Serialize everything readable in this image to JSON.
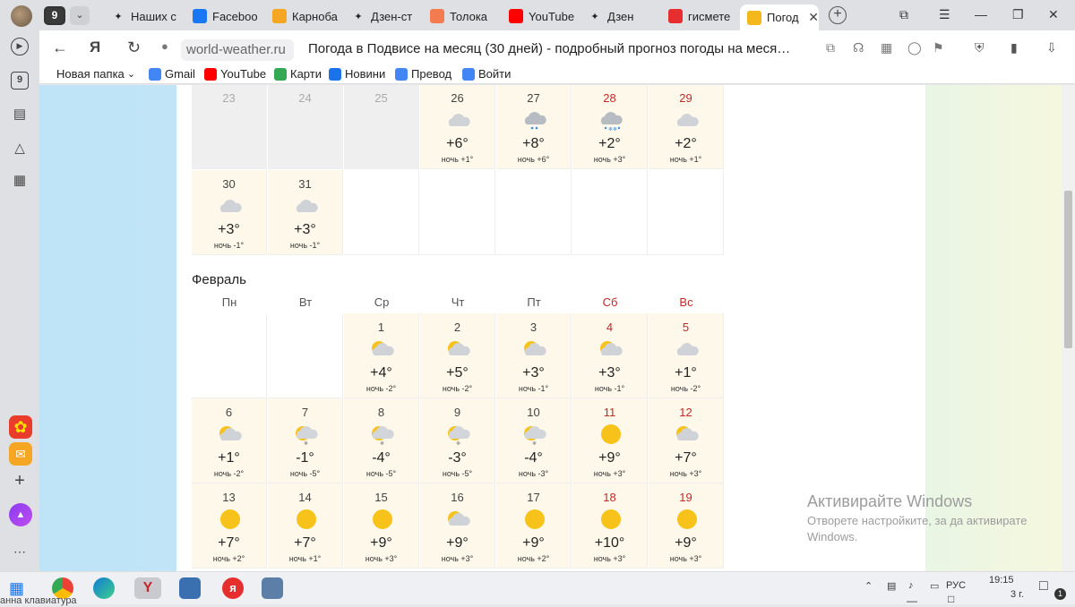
{
  "browser": {
    "tab_count": "9",
    "tabs": [
      {
        "label": "Наших с",
        "icon": "sparkle-icon",
        "color": "#222"
      },
      {
        "label": "Faceboo",
        "icon": "facebook-icon",
        "color": "#1877f2"
      },
      {
        "label": "Карноба",
        "icon": "k-logo-icon",
        "color": "#f5a623"
      },
      {
        "label": "Дзен-ст",
        "icon": "sparkle-icon",
        "color": "#222"
      },
      {
        "label": "Толока",
        "icon": "toloka-icon",
        "color": "#f47b4f"
      },
      {
        "label": "YouTube",
        "icon": "youtube-icon",
        "color": "#ff0000"
      },
      {
        "label": "Дзен",
        "icon": "sparkle-icon",
        "color": "#222"
      },
      {
        "label": "гисмете",
        "icon": "yandex-icon",
        "color": "#e62e2e"
      },
      {
        "label": "Погод",
        "icon": "weather-icon",
        "color": "#f5b81c",
        "active": true
      }
    ],
    "url": "world-weather.ru",
    "page_title": "Погода в Подвисе на месяц (30 дней) - подробный прогноз погоды на меся…",
    "bookmarks": [
      {
        "label": "Новая папка",
        "icon": "chevron-down-icon"
      },
      {
        "label": "Gmail",
        "icon": "google-icon",
        "color": "#4285f4"
      },
      {
        "label": "YouTube",
        "icon": "youtube-icon",
        "color": "#ff0000"
      },
      {
        "label": "Карти",
        "icon": "maps-icon",
        "color": "#34a853"
      },
      {
        "label": "Новини",
        "icon": "news-icon",
        "color": "#1a73e8"
      },
      {
        "label": "Превод",
        "icon": "translate-icon",
        "color": "#4285f4"
      },
      {
        "label": "Войти",
        "icon": "google-icon",
        "color": "#4285f4"
      }
    ]
  },
  "calendar": {
    "january_rows": [
      [
        {
          "day": "23",
          "state": "past"
        },
        {
          "day": "24",
          "state": "past"
        },
        {
          "day": "25",
          "state": "past"
        },
        {
          "day": "26",
          "state": "fc",
          "weather": "cloudy",
          "temp": "+6°",
          "night": "ночь +1°"
        },
        {
          "day": "27",
          "state": "fc",
          "weather": "rain",
          "temp": "+8°",
          "night": "ночь +6°"
        },
        {
          "day": "28",
          "state": "fc",
          "weather": "sleet",
          "temp": "+2°",
          "night": "ночь +3°",
          "weekend": true
        },
        {
          "day": "29",
          "state": "fc",
          "weather": "cloudy",
          "temp": "+2°",
          "night": "ночь +1°",
          "weekend": true
        }
      ],
      [
        {
          "day": "30",
          "state": "fc",
          "weather": "cloudy",
          "temp": "+3°",
          "night": "ночь -1°"
        },
        {
          "day": "31",
          "state": "fc",
          "weather": "cloudy",
          "temp": "+3°",
          "night": "ночь -1°"
        },
        {
          "day": "",
          "state": "empty"
        },
        {
          "day": "",
          "state": "empty"
        },
        {
          "day": "",
          "state": "empty"
        },
        {
          "day": "",
          "state": "empty"
        },
        {
          "day": "",
          "state": "empty"
        }
      ]
    ],
    "month_label": "Февраль",
    "weekdays": [
      "Пн",
      "Вт",
      "Ср",
      "Чт",
      "Пт",
      "Сб",
      "Вс"
    ],
    "february_rows": [
      [
        {
          "day": "",
          "state": "empty"
        },
        {
          "day": "",
          "state": "empty"
        },
        {
          "day": "1",
          "state": "fc",
          "weather": "partly",
          "temp": "+4°",
          "night": "ночь -2°"
        },
        {
          "day": "2",
          "state": "fc",
          "weather": "partly",
          "temp": "+5°",
          "night": "ночь -2°"
        },
        {
          "day": "3",
          "state": "fc",
          "weather": "partly",
          "temp": "+3°",
          "night": "ночь -1°"
        },
        {
          "day": "4",
          "state": "fc",
          "weather": "partly",
          "temp": "+3°",
          "night": "ночь -1°",
          "weekend": true
        },
        {
          "day": "5",
          "state": "fc",
          "weather": "cloudy",
          "temp": "+1°",
          "night": "ночь -2°",
          "weekend": true
        }
      ],
      [
        {
          "day": "6",
          "state": "fc",
          "weather": "partly",
          "temp": "+1°",
          "night": "ночь -2°"
        },
        {
          "day": "7",
          "state": "fc",
          "weather": "snow",
          "temp": "-1°",
          "night": "ночь -5°"
        },
        {
          "day": "8",
          "state": "fc",
          "weather": "snow",
          "temp": "-4°",
          "night": "ночь -5°"
        },
        {
          "day": "9",
          "state": "fc",
          "weather": "snow",
          "temp": "-3°",
          "night": "ночь -5°"
        },
        {
          "day": "10",
          "state": "fc",
          "weather": "snow",
          "temp": "-4°",
          "night": "ночь -3°"
        },
        {
          "day": "11",
          "state": "fc",
          "weather": "sun",
          "temp": "+9°",
          "night": "ночь +3°",
          "weekend": true
        },
        {
          "day": "12",
          "state": "fc",
          "weather": "partly",
          "temp": "+7°",
          "night": "ночь +3°",
          "weekend": true
        }
      ],
      [
        {
          "day": "13",
          "state": "fc",
          "weather": "sun",
          "temp": "+7°",
          "night": "ночь +2°"
        },
        {
          "day": "14",
          "state": "fc",
          "weather": "sun",
          "temp": "+7°",
          "night": "ночь +1°"
        },
        {
          "day": "15",
          "state": "fc",
          "weather": "sun",
          "temp": "+9°",
          "night": "ночь +3°"
        },
        {
          "day": "16",
          "state": "fc",
          "weather": "partly",
          "temp": "+9°",
          "night": "ночь +3°"
        },
        {
          "day": "17",
          "state": "fc",
          "weather": "sun",
          "temp": "+9°",
          "night": "ночь +2°"
        },
        {
          "day": "18",
          "state": "fc",
          "weather": "sun",
          "temp": "+10°",
          "night": "ночь +3°",
          "weekend": true
        },
        {
          "day": "19",
          "state": "fc",
          "weather": "sun",
          "temp": "+9°",
          "night": "ночь +3°",
          "weekend": true
        }
      ]
    ]
  },
  "activation": {
    "title": "Активирайте Windows",
    "text": "Отворете настройките, за да активирате Windows."
  },
  "taskbar": {
    "time": "19:15",
    "lang": "РУС",
    "date_fragment": "3 г.",
    "notif_count": "1",
    "keyboard_text": "анна клавиатура"
  }
}
